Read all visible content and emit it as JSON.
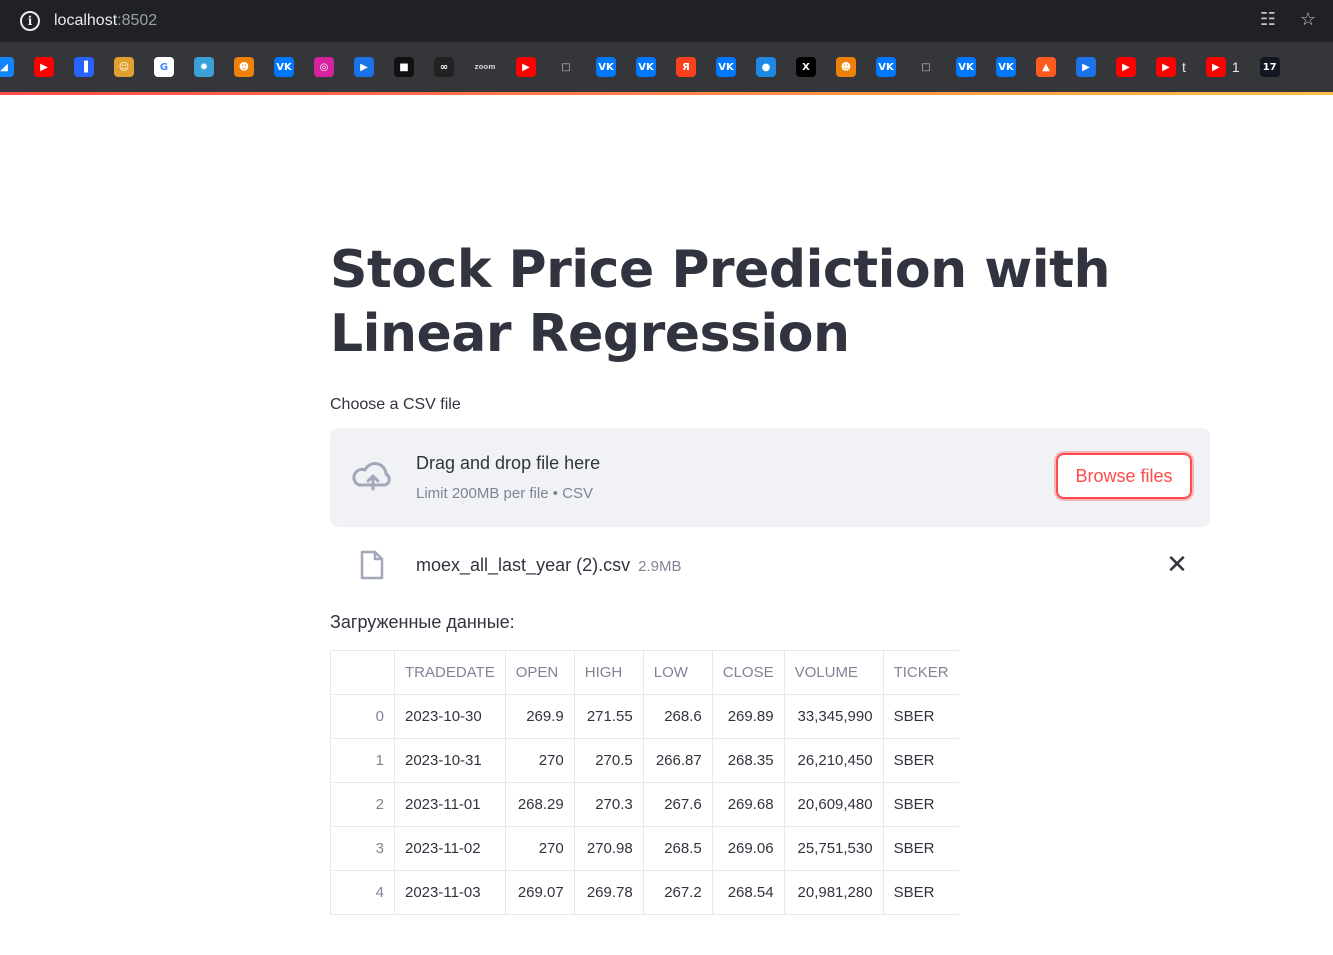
{
  "browser": {
    "url_host": "localhost",
    "url_port": ":8502",
    "bookmarks": [
      {
        "icon": "bluesky-icon",
        "color": "#1185fe",
        "glyph": "◢",
        "label": ""
      },
      {
        "icon": "youtube-icon",
        "color": "#ff0000",
        "glyph": "▶",
        "label": ""
      },
      {
        "icon": "chart-app-icon",
        "color": "#2962ff",
        "glyph": "▐",
        "label": ""
      },
      {
        "icon": "face-icon",
        "color": "#e0a030",
        "glyph": "☺",
        "label": ""
      },
      {
        "icon": "google-icon",
        "color": "#ffffff",
        "glyph": "G",
        "label": ""
      },
      {
        "icon": "app-icon",
        "color": "#3aa0d8",
        "glyph": "✹",
        "label": ""
      },
      {
        "icon": "odnoklassniki-icon",
        "color": "#ee8208",
        "glyph": "☻",
        "label": ""
      },
      {
        "icon": "vk-icon",
        "color": "#0077ff",
        "glyph": "VK",
        "label": ""
      },
      {
        "icon": "instagram-icon",
        "color": "#d6249f",
        "glyph": "◎",
        "label": ""
      },
      {
        "icon": "play-icon",
        "color": "#1a73e8",
        "glyph": "▶",
        "label": ""
      },
      {
        "icon": "unsplash-icon",
        "color": "#111111",
        "glyph": "■",
        "label": ""
      },
      {
        "icon": "link-icon",
        "color": "#222222",
        "glyph": "∞",
        "label": ""
      },
      {
        "icon": "zoom-icon",
        "color": "#35363a",
        "glyph": "zoom",
        "label": ""
      },
      {
        "icon": "youtube-icon",
        "color": "#ff0000",
        "glyph": "▶",
        "label": ""
      },
      {
        "icon": "folder-icon",
        "color": "#35363a",
        "glyph": "□",
        "label": ""
      },
      {
        "icon": "vk-icon",
        "color": "#0077ff",
        "glyph": "VK",
        "label": ""
      },
      {
        "icon": "vk-icon",
        "color": "#0077ff",
        "glyph": "VK",
        "label": ""
      },
      {
        "icon": "yandex-icon",
        "color": "#fc3f1d",
        "glyph": "Я",
        "label": ""
      },
      {
        "icon": "vk-icon",
        "color": "#0077ff",
        "glyph": "VK",
        "label": ""
      },
      {
        "icon": "web-icon",
        "color": "#1e88e5",
        "glyph": "●",
        "label": ""
      },
      {
        "icon": "x-icon",
        "color": "#000000",
        "glyph": "X",
        "label": ""
      },
      {
        "icon": "odnoklassniki-icon",
        "color": "#ee8208",
        "glyph": "☻",
        "label": ""
      },
      {
        "icon": "vk-icon",
        "color": "#0077ff",
        "glyph": "VK",
        "label": ""
      },
      {
        "icon": "folder-icon",
        "color": "#35363a",
        "glyph": "□",
        "label": ""
      },
      {
        "icon": "vk-icon",
        "color": "#0077ff",
        "glyph": "VK",
        "label": ""
      },
      {
        "icon": "vk-icon",
        "color": "#0077ff",
        "glyph": "VK",
        "label": ""
      },
      {
        "icon": "app-icon",
        "color": "#ff5a1f",
        "glyph": "▲",
        "label": ""
      },
      {
        "icon": "play-icon",
        "color": "#1a73e8",
        "glyph": "▶",
        "label": ""
      },
      {
        "icon": "youtube-icon",
        "color": "#ff0000",
        "glyph": "▶",
        "label": ""
      },
      {
        "icon": "youtube-icon",
        "color": "#ff0000",
        "glyph": "▶",
        "label": "t"
      },
      {
        "icon": "youtube-icon",
        "color": "#ff0000",
        "glyph": "▶",
        "label": "1"
      },
      {
        "icon": "tradingview-icon",
        "color": "#131722",
        "glyph": "17",
        "label": ""
      }
    ]
  },
  "page": {
    "title": "Stock Price Prediction with Linear Regression",
    "uploader_label": "Choose a CSV file",
    "dropzone_main": "Drag and drop file here",
    "dropzone_sub": "Limit 200MB per file • CSV",
    "browse_label": "Browse files",
    "file_name": "moex_all_last_year (2).csv",
    "file_size": "2.9MB",
    "section_label": "Загруженные данные:",
    "accent_color": "#ff4b4b"
  },
  "table": {
    "columns": [
      "",
      "TRADEDATE",
      "OPEN",
      "HIGH",
      "LOW",
      "CLOSE",
      "VOLUME",
      "TICKER"
    ],
    "rows": [
      [
        "0",
        "2023-10-30",
        "269.9",
        "271.55",
        "268.6",
        "269.89",
        "33,345,990",
        "SBER"
      ],
      [
        "1",
        "2023-10-31",
        "270",
        "270.5",
        "266.87",
        "268.35",
        "26,210,450",
        "SBER"
      ],
      [
        "2",
        "2023-11-01",
        "268.29",
        "270.3",
        "267.6",
        "269.68",
        "20,609,480",
        "SBER"
      ],
      [
        "3",
        "2023-11-02",
        "270",
        "270.98",
        "268.5",
        "269.06",
        "25,751,530",
        "SBER"
      ],
      [
        "4",
        "2023-11-03",
        "269.07",
        "269.78",
        "267.2",
        "268.54",
        "20,981,280",
        "SBER"
      ]
    ]
  }
}
